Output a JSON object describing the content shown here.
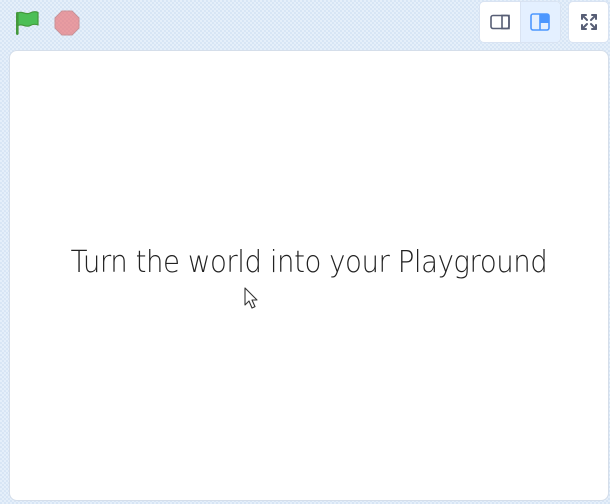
{
  "controls": {
    "green_flag_icon": "green-flag-icon",
    "stop_icon": "stop-sign-icon",
    "layout_small_icon": "small-stage-layout-icon",
    "layout_normal_icon": "normal-stage-layout-icon",
    "fullscreen_icon": "fullscreen-icon"
  },
  "stage": {
    "text": "Turn the world  into your Playground"
  },
  "colors": {
    "flag_green": "#4cbf56",
    "stop_red": "#ec5959",
    "accent_blue": "#4c97ff",
    "stage_background": "#ffffff",
    "page_background": "#e5effa"
  }
}
